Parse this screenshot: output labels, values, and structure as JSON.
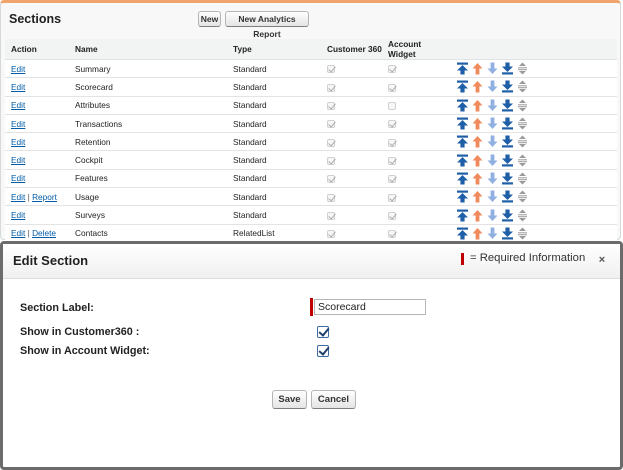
{
  "panel": {
    "title": "Sections",
    "new_label": "New",
    "analytics_label": "New Analytics Report"
  },
  "table": {
    "headers": [
      "Action",
      "Name",
      "Type",
      "Customer 360",
      "Account Widget"
    ],
    "rows": [
      {
        "actions": [
          "Edit"
        ],
        "name": "Summary",
        "type": "Standard",
        "c360": true,
        "widget": true
      },
      {
        "actions": [
          "Edit"
        ],
        "name": "Scorecard",
        "type": "Standard",
        "c360": true,
        "widget": true
      },
      {
        "actions": [
          "Edit"
        ],
        "name": "Attributes",
        "type": "Standard",
        "c360": true,
        "widget": false
      },
      {
        "actions": [
          "Edit"
        ],
        "name": "Transactions",
        "type": "Standard",
        "c360": true,
        "widget": true
      },
      {
        "actions": [
          "Edit"
        ],
        "name": "Retention",
        "type": "Standard",
        "c360": true,
        "widget": true
      },
      {
        "actions": [
          "Edit"
        ],
        "name": "Cockpit",
        "type": "Standard",
        "c360": true,
        "widget": true
      },
      {
        "actions": [
          "Edit"
        ],
        "name": "Features",
        "type": "Standard",
        "c360": true,
        "widget": true
      },
      {
        "actions": [
          "Edit",
          "Report"
        ],
        "name": "Usage",
        "type": "Standard",
        "c360": true,
        "widget": true
      },
      {
        "actions": [
          "Edit"
        ],
        "name": "Surveys",
        "type": "Standard",
        "c360": true,
        "widget": true
      },
      {
        "actions": [
          "Edit",
          "Delete"
        ],
        "name": "Contacts",
        "type": "RelatedList",
        "c360": true,
        "widget": true
      }
    ],
    "row_icons": [
      "move-top-icon",
      "move-up-icon",
      "move-down-icon",
      "move-bottom-icon",
      "drag-handle-icon"
    ]
  },
  "modal": {
    "title": "Edit Section",
    "required_text": "= Required Information",
    "close_glyph": "×",
    "label_section": "Section Label:",
    "section_value": "Scorecard",
    "label_c360": "Show in Customer360 :",
    "label_widget": "Show in Account Widget:",
    "c360_checked": true,
    "widget_checked": true,
    "save_label": "Save",
    "cancel_label": "Cancel"
  },
  "colors": {
    "accent_orange": "#f0a36a",
    "link_blue": "#015ba7",
    "icon_blue": "#1f5fa8",
    "icon_light_blue": "#8fb0e0",
    "icon_orange": "#f08a5d",
    "required_red": "#c00000"
  }
}
